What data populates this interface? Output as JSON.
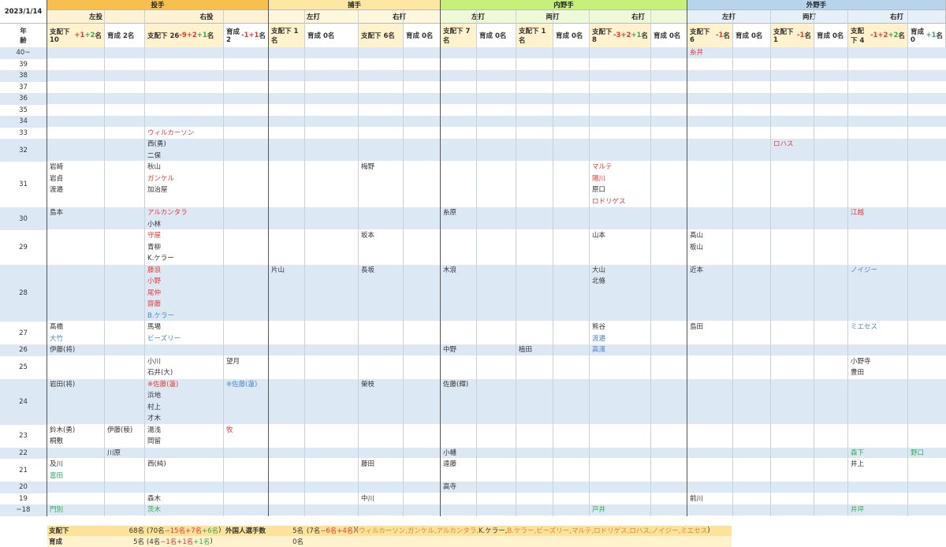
{
  "date": "2023/1/14",
  "age_header": [
    "年",
    "齢"
  ],
  "colors": {
    "red": "#e53935",
    "blue": "#4a86c8",
    "green": "#2eaa57",
    "black": "#333333",
    "orange": "#e2802c"
  },
  "positions": [
    {
      "label": "投手",
      "color": "#f7c04e"
    },
    {
      "label": "捕手",
      "color": "#fde7a2"
    },
    {
      "label": "内野手",
      "color": "#c6f07a"
    },
    {
      "label": "外野手",
      "color": "#b8d4ec"
    }
  ],
  "subgroups": [
    "左投",
    "右投",
    "左打",
    "右打",
    "左打",
    "両打",
    "右打",
    "左打",
    "両打",
    "右打"
  ],
  "col_headers": [
    [
      {
        "t": "支配下 10",
        "c": "black"
      },
      {
        "t": "+1",
        "c": "red"
      },
      {
        "t": "+2",
        "c": "green"
      },
      {
        "t": "名",
        "c": "black"
      }
    ],
    [
      {
        "t": "育成 2名",
        "c": "black"
      }
    ],
    [
      {
        "t": "支配下 26",
        "c": "black"
      },
      {
        "t": "-9",
        "c": "red"
      },
      {
        "t": "+2",
        "c": "red"
      },
      {
        "t": "+1",
        "c": "green"
      },
      {
        "t": "名",
        "c": "black"
      }
    ],
    [
      {
        "t": "育成 2",
        "c": "black"
      },
      {
        "t": "-1",
        "c": "red"
      },
      {
        "t": "+1",
        "c": "red"
      },
      {
        "t": "名",
        "c": "black"
      }
    ],
    [
      {
        "t": "支配下 1名",
        "c": "black"
      }
    ],
    [
      {
        "t": "育成 0名",
        "c": "black"
      }
    ],
    [
      {
        "t": "支配下 6名",
        "c": "black"
      }
    ],
    [
      {
        "t": "育成 0名",
        "c": "black"
      }
    ],
    [
      {
        "t": "支配下 7名",
        "c": "black"
      }
    ],
    [
      {
        "t": "育成 0名",
        "c": "black"
      }
    ],
    [
      {
        "t": "支配下 1名",
        "c": "black"
      }
    ],
    [
      {
        "t": "育成 0名",
        "c": "black"
      }
    ],
    [
      {
        "t": "支配下 8",
        "c": "black"
      },
      {
        "t": "-3",
        "c": "red"
      },
      {
        "t": "+2",
        "c": "red"
      },
      {
        "t": "+1",
        "c": "green"
      },
      {
        "t": "名",
        "c": "black"
      }
    ],
    [
      {
        "t": "育成 0名",
        "c": "black"
      }
    ],
    [
      {
        "t": "支配下 6",
        "c": "black"
      },
      {
        "t": "-1",
        "c": "red"
      },
      {
        "t": "名",
        "c": "black"
      }
    ],
    [
      {
        "t": "育成 0名",
        "c": "black"
      }
    ],
    [
      {
        "t": "支配下 1",
        "c": "black"
      },
      {
        "t": "-1",
        "c": "red"
      },
      {
        "t": "名",
        "c": "black"
      }
    ],
    [
      {
        "t": "育成 0名",
        "c": "black"
      }
    ],
    [
      {
        "t": "支配下 4",
        "c": "black"
      },
      {
        "t": "-1",
        "c": "red"
      },
      {
        "t": "+2",
        "c": "red"
      },
      {
        "t": "+2",
        "c": "green"
      },
      {
        "t": "名",
        "c": "black"
      }
    ],
    [
      {
        "t": "育成 0",
        "c": "black"
      },
      {
        "t": "+1",
        "c": "green"
      },
      {
        "t": "名",
        "c": "black"
      }
    ]
  ],
  "ages": [
    "40~",
    "39",
    "38",
    "37",
    "36",
    "35",
    "34",
    "33",
    "32",
    "31",
    "30",
    "29",
    "28",
    "27",
    "26",
    "25",
    "24",
    "23",
    "22",
    "21",
    "20",
    "19",
    "~18"
  ],
  "players": [
    {
      "age": "40~",
      "col": 14,
      "names": [
        {
          "n": "糸井",
          "c": "red"
        }
      ]
    },
    {
      "age": "33",
      "col": 2,
      "names": [
        {
          "n": "ウィルカーソン",
          "c": "red"
        }
      ]
    },
    {
      "age": "32",
      "col": 2,
      "names": [
        {
          "n": "西(勇)",
          "c": "black"
        },
        {
          "n": "二保",
          "c": "black"
        }
      ]
    },
    {
      "age": "32",
      "col": 16,
      "names": [
        {
          "n": "ロハス",
          "c": "red"
        }
      ]
    },
    {
      "age": "31",
      "col": 0,
      "names": [
        {
          "n": "岩崎",
          "c": "black"
        },
        {
          "n": "岩貞",
          "c": "black"
        },
        {
          "n": "渡邉",
          "c": "black"
        }
      ]
    },
    {
      "age": "31",
      "col": 2,
      "names": [
        {
          "n": "秋山",
          "c": "black"
        },
        {
          "n": "ガンケル",
          "c": "red"
        },
        {
          "n": "加治屋",
          "c": "black"
        }
      ]
    },
    {
      "age": "31",
      "col": 6,
      "names": [
        {
          "n": "梅野",
          "c": "black"
        }
      ]
    },
    {
      "age": "31",
      "col": 12,
      "names": [
        {
          "n": "マルテ",
          "c": "red"
        },
        {
          "n": "陽川",
          "c": "red"
        },
        {
          "n": "原口",
          "c": "black"
        },
        {
          "n": "ロドリゲス",
          "c": "red"
        }
      ]
    },
    {
      "age": "30",
      "col": 0,
      "names": [
        {
          "n": "島本",
          "c": "black"
        }
      ]
    },
    {
      "age": "30",
      "col": 2,
      "names": [
        {
          "n": "アルカンタラ",
          "c": "red"
        },
        {
          "n": "小林",
          "c": "black"
        }
      ]
    },
    {
      "age": "30",
      "col": 8,
      "names": [
        {
          "n": "糸原",
          "c": "black"
        }
      ]
    },
    {
      "age": "30",
      "col": 18,
      "names": [
        {
          "n": "江越",
          "c": "red"
        }
      ]
    },
    {
      "age": "29",
      "col": 2,
      "names": [
        {
          "n": "守屋",
          "c": "red"
        },
        {
          "n": "青柳",
          "c": "black"
        },
        {
          "n": "K.ケラー",
          "c": "black"
        }
      ]
    },
    {
      "age": "29",
      "col": 6,
      "names": [
        {
          "n": "坂本",
          "c": "black"
        }
      ]
    },
    {
      "age": "29",
      "col": 12,
      "names": [
        {
          "n": "山本",
          "c": "black"
        }
      ]
    },
    {
      "age": "29",
      "col": 14,
      "names": [
        {
          "n": "髙山",
          "c": "black"
        },
        {
          "n": "板山",
          "c": "black"
        }
      ]
    },
    {
      "age": "28",
      "col": 2,
      "names": [
        {
          "n": "藤浪",
          "c": "red"
        },
        {
          "n": "小野",
          "c": "red"
        },
        {
          "n": "尾仲",
          "c": "red"
        },
        {
          "n": "齋藤",
          "c": "red"
        },
        {
          "n": "B.ケラー",
          "c": "blue"
        }
      ]
    },
    {
      "age": "28",
      "col": 4,
      "names": [
        {
          "n": "片山",
          "c": "black"
        }
      ]
    },
    {
      "age": "28",
      "col": 6,
      "names": [
        {
          "n": "長坂",
          "c": "black"
        }
      ]
    },
    {
      "age": "28",
      "col": 8,
      "names": [
        {
          "n": "木浪",
          "c": "black"
        }
      ]
    },
    {
      "age": "28",
      "col": 12,
      "names": [
        {
          "n": "大山",
          "c": "black"
        },
        {
          "n": "北條",
          "c": "black"
        }
      ]
    },
    {
      "age": "28",
      "col": 14,
      "names": [
        {
          "n": "近本",
          "c": "black"
        }
      ]
    },
    {
      "age": "28",
      "col": 18,
      "names": [
        {
          "n": "ノイジー",
          "c": "blue"
        }
      ]
    },
    {
      "age": "27",
      "col": 0,
      "names": [
        {
          "n": "髙橋",
          "c": "black"
        },
        {
          "n": "大竹",
          "c": "blue"
        }
      ]
    },
    {
      "age": "27",
      "col": 2,
      "names": [
        {
          "n": "馬場",
          "c": "black"
        },
        {
          "n": "ビーズリー",
          "c": "blue"
        }
      ]
    },
    {
      "age": "27",
      "col": 12,
      "names": [
        {
          "n": "熊谷",
          "c": "black"
        },
        {
          "n": "渡邉",
          "c": "blue"
        }
      ]
    },
    {
      "age": "27",
      "col": 14,
      "names": [
        {
          "n": "島田",
          "c": "black"
        }
      ]
    },
    {
      "age": "27",
      "col": 18,
      "names": [
        {
          "n": "ミエセス",
          "c": "blue"
        }
      ]
    },
    {
      "age": "26",
      "col": 0,
      "names": [
        {
          "n": "伊藤(将)",
          "c": "black"
        }
      ]
    },
    {
      "age": "26",
      "col": 8,
      "names": [
        {
          "n": "中野",
          "c": "black"
        }
      ]
    },
    {
      "age": "26",
      "col": 10,
      "names": [
        {
          "n": "植田",
          "c": "black"
        }
      ]
    },
    {
      "age": "26",
      "col": 12,
      "names": [
        {
          "n": "高濱",
          "c": "blue"
        }
      ]
    },
    {
      "age": "25",
      "col": 2,
      "names": [
        {
          "n": "小川",
          "c": "black"
        },
        {
          "n": "石井(大)",
          "c": "black"
        }
      ]
    },
    {
      "age": "25",
      "col": 3,
      "names": [
        {
          "n": "望月",
          "c": "black"
        }
      ]
    },
    {
      "age": "25",
      "col": 18,
      "names": [
        {
          "n": "小野寺",
          "c": "black"
        },
        {
          "n": "豊田",
          "c": "black"
        }
      ]
    },
    {
      "age": "24",
      "col": 0,
      "names": [
        {
          "n": "岩田(将)",
          "c": "black"
        }
      ]
    },
    {
      "age": "24",
      "col": 2,
      "names": [
        {
          "n": "※佐藤(蓮)",
          "c": "red"
        },
        {
          "n": "浜地",
          "c": "black"
        },
        {
          "n": "村上",
          "c": "black"
        },
        {
          "n": "才木",
          "c": "black"
        }
      ]
    },
    {
      "age": "24",
      "col": 3,
      "names": [
        {
          "n": "※佐藤(蓮)",
          "c": "blue"
        }
      ]
    },
    {
      "age": "24",
      "col": 6,
      "names": [
        {
          "n": "榮枝",
          "c": "black"
        }
      ]
    },
    {
      "age": "24",
      "col": 8,
      "names": [
        {
          "n": "佐藤(輝)",
          "c": "black"
        }
      ]
    },
    {
      "age": "23",
      "col": 0,
      "names": [
        {
          "n": "鈴木(勇)",
          "c": "black"
        },
        {
          "n": "桐敷",
          "c": "black"
        }
      ]
    },
    {
      "age": "23",
      "col": 1,
      "names": [
        {
          "n": "伊藤(稜)",
          "c": "black"
        }
      ]
    },
    {
      "age": "23",
      "col": 2,
      "names": [
        {
          "n": "湯浅",
          "c": "black"
        },
        {
          "n": "岡留",
          "c": "black"
        }
      ]
    },
    {
      "age": "23",
      "col": 3,
      "names": [
        {
          "n": "牧",
          "c": "red"
        }
      ]
    },
    {
      "age": "22",
      "col": 1,
      "names": [
        {
          "n": "川原",
          "c": "black"
        }
      ]
    },
    {
      "age": "22",
      "col": 8,
      "names": [
        {
          "n": "小幡",
          "c": "black"
        }
      ]
    },
    {
      "age": "22",
      "col": 18,
      "names": [
        {
          "n": "森下",
          "c": "green"
        }
      ]
    },
    {
      "age": "22",
      "col": 19,
      "names": [
        {
          "n": "野口",
          "c": "green"
        }
      ]
    },
    {
      "age": "21",
      "col": 0,
      "names": [
        {
          "n": "及川",
          "c": "black"
        },
        {
          "n": "富田",
          "c": "green"
        }
      ]
    },
    {
      "age": "21",
      "col": 2,
      "names": [
        {
          "n": "西(純)",
          "c": "black"
        }
      ]
    },
    {
      "age": "21",
      "col": 6,
      "names": [
        {
          "n": "藤田",
          "c": "black"
        }
      ]
    },
    {
      "age": "21",
      "col": 8,
      "names": [
        {
          "n": "遠藤",
          "c": "black"
        }
      ]
    },
    {
      "age": "21",
      "col": 18,
      "names": [
        {
          "n": "井上",
          "c": "black"
        }
      ]
    },
    {
      "age": "20",
      "col": 8,
      "names": [
        {
          "n": "高寺",
          "c": "black"
        }
      ]
    },
    {
      "age": "19",
      "col": 2,
      "names": [
        {
          "n": "森木",
          "c": "black"
        }
      ]
    },
    {
      "age": "19",
      "col": 6,
      "names": [
        {
          "n": "中川",
          "c": "black"
        }
      ]
    },
    {
      "age": "19",
      "col": 14,
      "names": [
        {
          "n": "前川",
          "c": "black"
        }
      ]
    },
    {
      "age": "~18",
      "col": 0,
      "names": [
        {
          "n": "門別",
          "c": "green"
        }
      ]
    },
    {
      "age": "~18",
      "col": 2,
      "names": [
        {
          "n": "茨木",
          "c": "green"
        }
      ]
    },
    {
      "age": "~18",
      "col": 12,
      "names": [
        {
          "n": "戸井",
          "c": "green"
        }
      ]
    },
    {
      "age": "~18",
      "col": 18,
      "names": [
        {
          "n": "井坪",
          "c": "green"
        }
      ]
    }
  ],
  "footer": {
    "shihaika_label": "支配下",
    "shihaika_value": "68名",
    "shihaika_breakdown": [
      {
        "t": "(70名",
        "c": "black"
      },
      {
        "t": "−15名",
        "c": "red"
      },
      {
        "t": "+7名",
        "c": "red"
      },
      {
        "t": "+6名",
        "c": "green"
      },
      {
        "t": ")",
        "c": "black"
      }
    ],
    "foreign_label": "外国人選手数",
    "foreign_value": "5名",
    "foreign_breakdown": [
      {
        "t": "(7名",
        "c": "black"
      },
      {
        "t": "−6名",
        "c": "red"
      },
      {
        "t": "+4名",
        "c": "red"
      },
      {
        "t": ")",
        "c": "black"
      },
      {
        "t": "  (",
        "c": "black"
      },
      {
        "t": "ウィルカーソン,ガンケル,アルカンタラ,",
        "c": "orange"
      },
      {
        "t": "K.ケラー,",
        "c": "black"
      },
      {
        "t": "B.ケラー,ビーズリー,マルテ,ロドリゲス,ロハス,ノイジー,ミエセス",
        "c": "orange"
      },
      {
        "t": ")",
        "c": "black"
      }
    ],
    "ikusei_label": "育成",
    "ikusei_value": "5名",
    "ikusei_breakdown": [
      {
        "t": "(4名",
        "c": "black"
      },
      {
        "t": "−1名",
        "c": "red"
      },
      {
        "t": "+1名",
        "c": "red"
      },
      {
        "t": "+1名",
        "c": "green"
      },
      {
        "t": ")",
        "c": "black"
      }
    ],
    "foreign_ikusei_value": "0名"
  }
}
